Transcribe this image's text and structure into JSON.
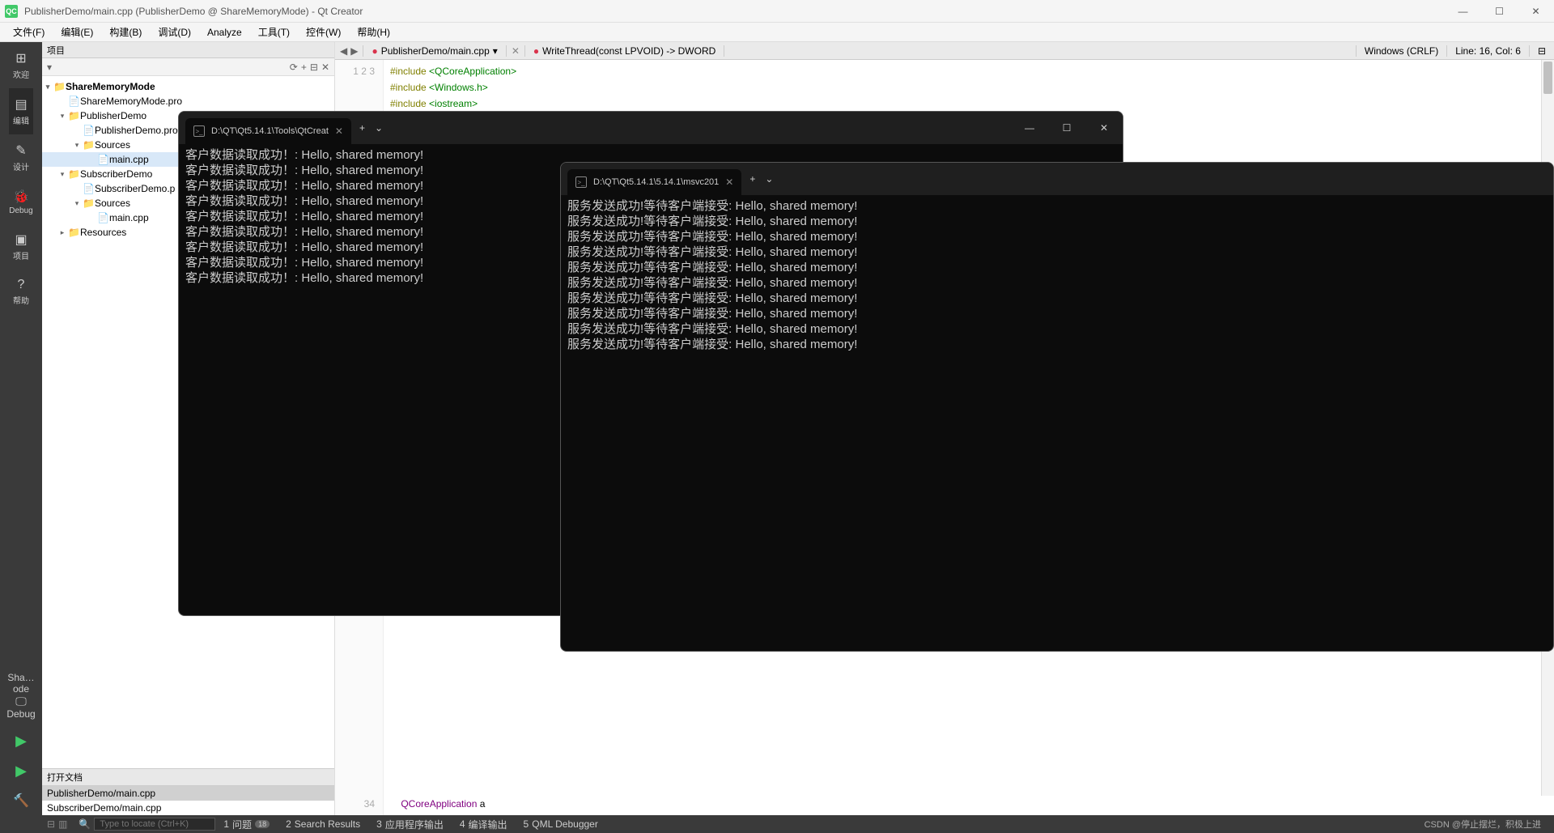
{
  "titlebar": {
    "title": "PublisherDemo/main.cpp (PublisherDemo @ ShareMemoryMode) - Qt Creator"
  },
  "menubar": [
    "文件(F)",
    "编辑(E)",
    "构建(B)",
    "调试(D)",
    "Analyze",
    "工具(T)",
    "控件(W)",
    "帮助(H)"
  ],
  "sidebar_items": [
    {
      "label": "欢迎",
      "icon": "⊞"
    },
    {
      "label": "编辑",
      "icon": "▤"
    },
    {
      "label": "设计",
      "icon": "✎"
    },
    {
      "label": "Debug",
      "icon": "🐞"
    },
    {
      "label": "项目",
      "icon": "▣"
    },
    {
      "label": "帮助",
      "icon": "?"
    }
  ],
  "build": {
    "mode": "Sha…ode",
    "config": "Debug"
  },
  "panel": {
    "title": "项目"
  },
  "tree": [
    {
      "level": 0,
      "caret": "▾",
      "icon": "folder",
      "name": "ShareMemoryMode",
      "bold": true
    },
    {
      "level": 1,
      "caret": "",
      "icon": "file",
      "name": "ShareMemoryMode.pro"
    },
    {
      "level": 1,
      "caret": "▾",
      "icon": "folder",
      "name": "PublisherDemo"
    },
    {
      "level": 2,
      "caret": "",
      "icon": "file",
      "name": "PublisherDemo.pro"
    },
    {
      "level": 2,
      "caret": "▾",
      "icon": "folder",
      "name": "Sources"
    },
    {
      "level": 3,
      "caret": "",
      "icon": "file",
      "name": "main.cpp",
      "selected": true
    },
    {
      "level": 1,
      "caret": "▾",
      "icon": "folder",
      "name": "SubscriberDemo"
    },
    {
      "level": 2,
      "caret": "",
      "icon": "file",
      "name": "SubscriberDemo.pro",
      "visible_name": "SubscriberDemo.p"
    },
    {
      "level": 2,
      "caret": "▾",
      "icon": "folder",
      "name": "Sources"
    },
    {
      "level": 3,
      "caret": "",
      "icon": "file",
      "name": "main.cpp"
    },
    {
      "level": 1,
      "caret": "▸",
      "icon": "folder",
      "name": "Resources"
    }
  ],
  "open_docs": {
    "title": "打开文档",
    "items": [
      "PublisherDemo/main.cpp",
      "SubscriberDemo/main.cpp"
    ],
    "active": 0
  },
  "editor_toolbar": {
    "file": "PublisherDemo/main.cpp",
    "func": "WriteThread(const LPVOID) -> DWORD",
    "encoding": "Windows (CRLF)",
    "position": "Line: 16, Col: 6"
  },
  "code_lines": [
    {
      "n": 1,
      "html": "<span class='kw'>#include</span> <span class='inc'>&lt;QCoreApplication&gt;</span>"
    },
    {
      "n": 2,
      "html": "<span class='kw'>#include</span> <span class='inc'>&lt;Windows.h&gt;</span>"
    },
    {
      "n": 3,
      "html": "<span class='kw'>#include</span> <span class='inc'>&lt;iostream&gt;</span>"
    }
  ],
  "code_bottom": {
    "n": 34,
    "html": "    <span class='type'>QCoreApplication</span> a"
  },
  "locator": {
    "placeholder": "Type to locate (Ctrl+K)"
  },
  "footer_tabs": [
    {
      "n": "1",
      "label": "问题",
      "badge": "18"
    },
    {
      "n": "2",
      "label": "Search Results"
    },
    {
      "n": "3",
      "label": "应用程序输出"
    },
    {
      "n": "4",
      "label": "编译输出"
    },
    {
      "n": "5",
      "label": "QML Debugger"
    }
  ],
  "watermark": "CSDN @停止摆烂，积极上进",
  "terminal1": {
    "tab_title": "D:\\QT\\Qt5.14.1\\Tools\\QtCreat",
    "lines": [
      "客户数据读取成功！: Hello, shared memory!",
      "客户数据读取成功！: Hello, shared memory!",
      "客户数据读取成功！: Hello, shared memory!",
      "客户数据读取成功！: Hello, shared memory!",
      "客户数据读取成功！: Hello, shared memory!",
      "客户数据读取成功！: Hello, shared memory!",
      "客户数据读取成功！: Hello, shared memory!",
      "客户数据读取成功！: Hello, shared memory!",
      "客户数据读取成功！: Hello, shared memory!"
    ]
  },
  "terminal2": {
    "tab_title": "D:\\QT\\Qt5.14.1\\5.14.1\\msvc201",
    "lines": [
      "服务发送成功!等待客户端接受: Hello, shared memory!",
      "服务发送成功!等待客户端接受: Hello, shared memory!",
      "服务发送成功!等待客户端接受: Hello, shared memory!",
      "服务发送成功!等待客户端接受: Hello, shared memory!",
      "服务发送成功!等待客户端接受: Hello, shared memory!",
      "服务发送成功!等待客户端接受: Hello, shared memory!",
      "服务发送成功!等待客户端接受: Hello, shared memory!",
      "服务发送成功!等待客户端接受: Hello, shared memory!",
      "服务发送成功!等待客户端接受: Hello, shared memory!",
      "服务发送成功!等待客户端接受: Hello, shared memory!"
    ]
  }
}
